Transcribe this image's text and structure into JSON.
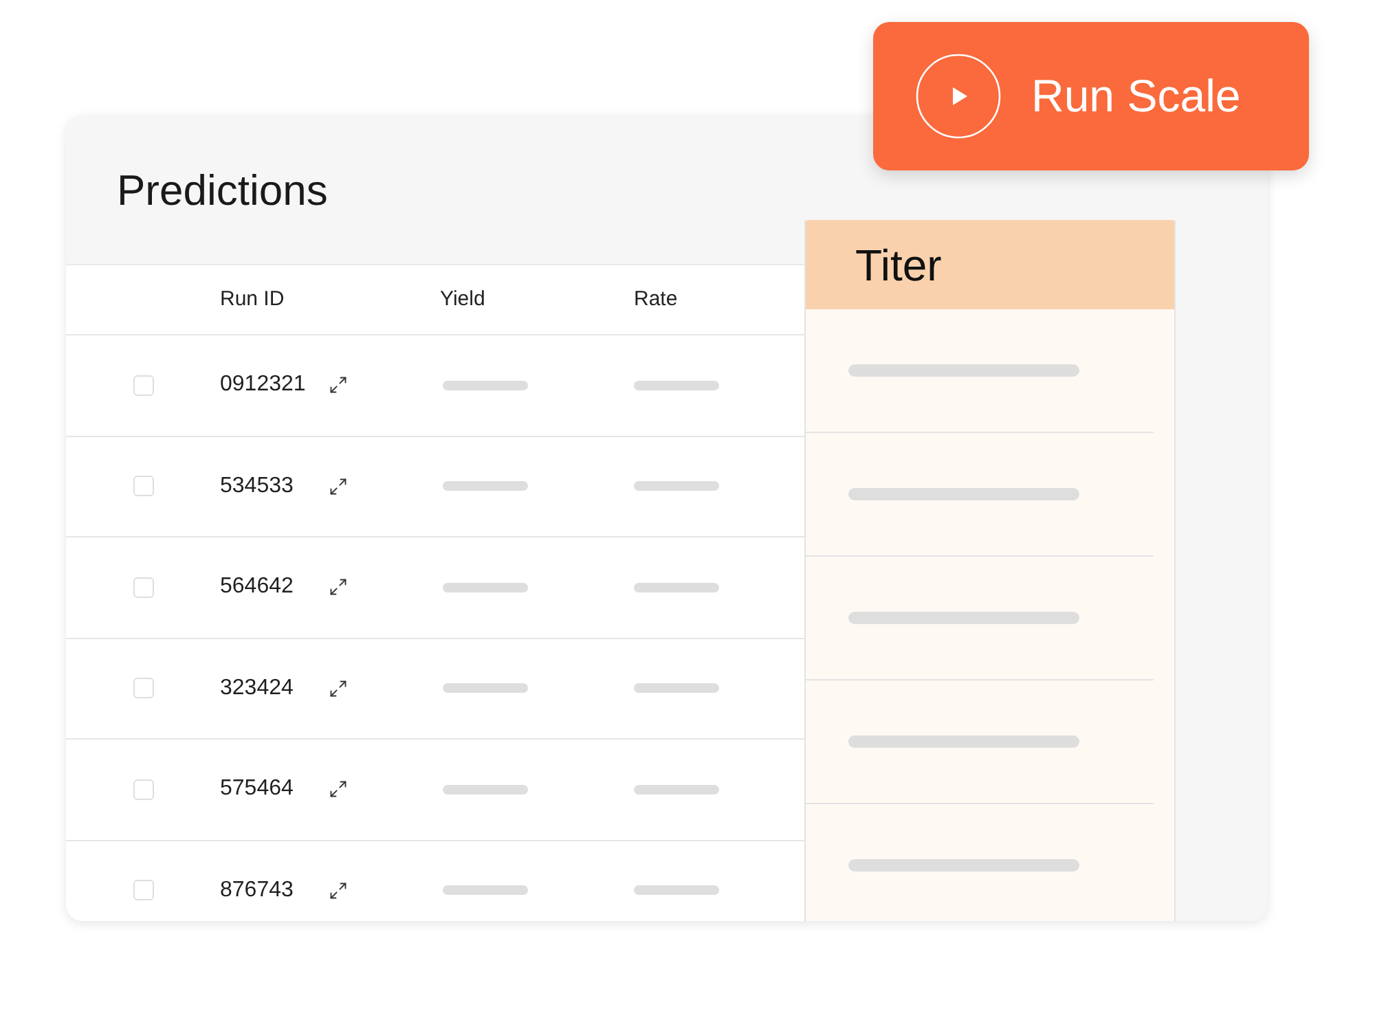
{
  "action_button": {
    "label": "Run Scale"
  },
  "panel": {
    "title": "Predictions",
    "table": {
      "columns": [
        "Run ID",
        "Yield",
        "Rate"
      ],
      "rows": [
        {
          "run_id": "0912321",
          "checked": false
        },
        {
          "run_id": "534533",
          "checked": false
        },
        {
          "run_id": "564642",
          "checked": false
        },
        {
          "run_id": "323424",
          "checked": false
        },
        {
          "run_id": "575464",
          "checked": false
        },
        {
          "run_id": "876743",
          "checked": false
        }
      ]
    },
    "highlight_column": {
      "title": "Titer"
    }
  }
}
